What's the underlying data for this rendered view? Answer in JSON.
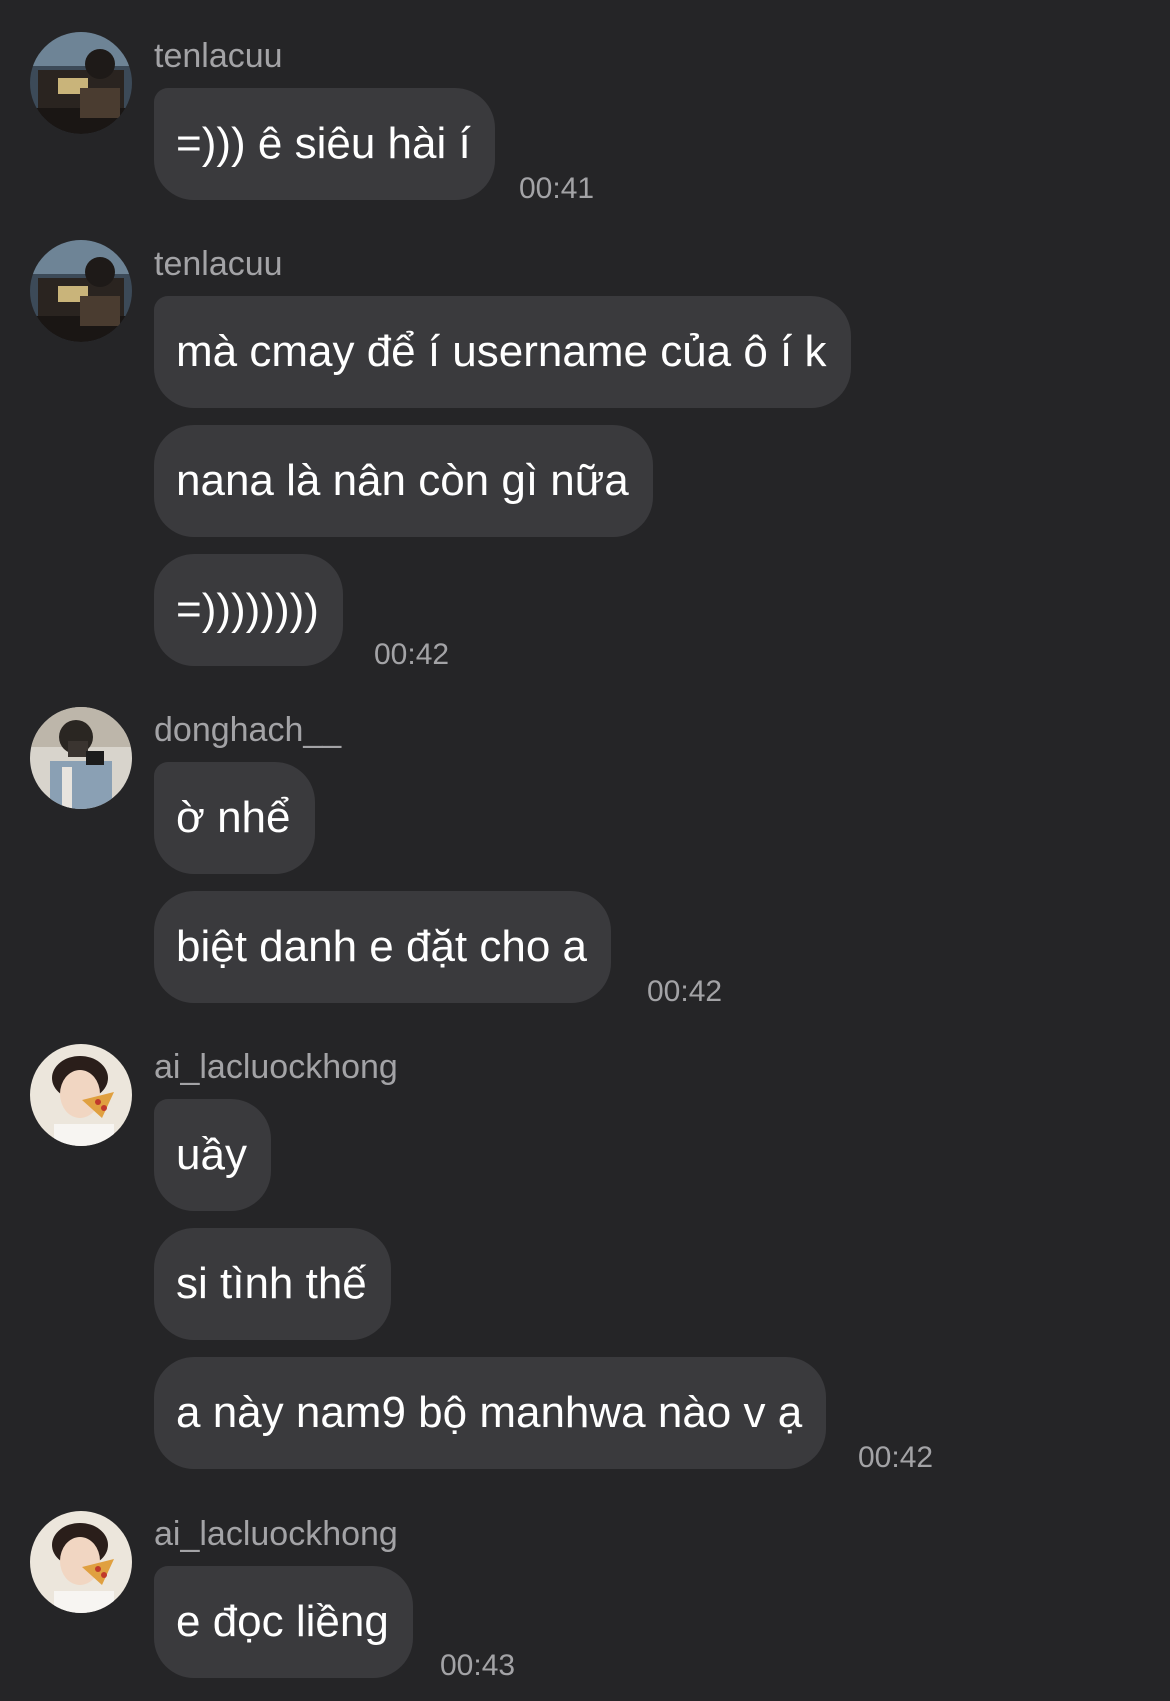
{
  "messages": [
    {
      "user": "tenlacuu",
      "avatar_icon": "avatar-tenlacuu",
      "bubbles": [
        "=))) ê siêu hài í"
      ],
      "time": "00:41"
    },
    {
      "user": "tenlacuu",
      "avatar_icon": "avatar-tenlacuu",
      "bubbles": [
        "mà cmay để í username của ô í k",
        "nana là nân còn gì nữa",
        "=))))))))"
      ],
      "time": "00:42"
    },
    {
      "user": "donghach__",
      "avatar_icon": "avatar-donghach",
      "bubbles": [
        "ờ nhể",
        "biệt danh e đặt cho a"
      ],
      "time": "00:42"
    },
    {
      "user": "ai_lacluockhong",
      "avatar_icon": "avatar-ai-lacluockhong",
      "bubbles": [
        "uầy",
        "si tình thế",
        "a này nam9 bộ manhwa nào v ạ"
      ],
      "time": "00:42"
    },
    {
      "user": "ai_lacluockhong",
      "avatar_icon": "avatar-ai-lacluockhong",
      "bubbles": [
        "e đọc liềng"
      ],
      "time": "00:43"
    }
  ],
  "colors": {
    "background": "#252527",
    "bubble": "#3a3a3d",
    "username": "#a3a3a6",
    "timestamp": "#a3a3a6",
    "text": "#ffffff"
  }
}
